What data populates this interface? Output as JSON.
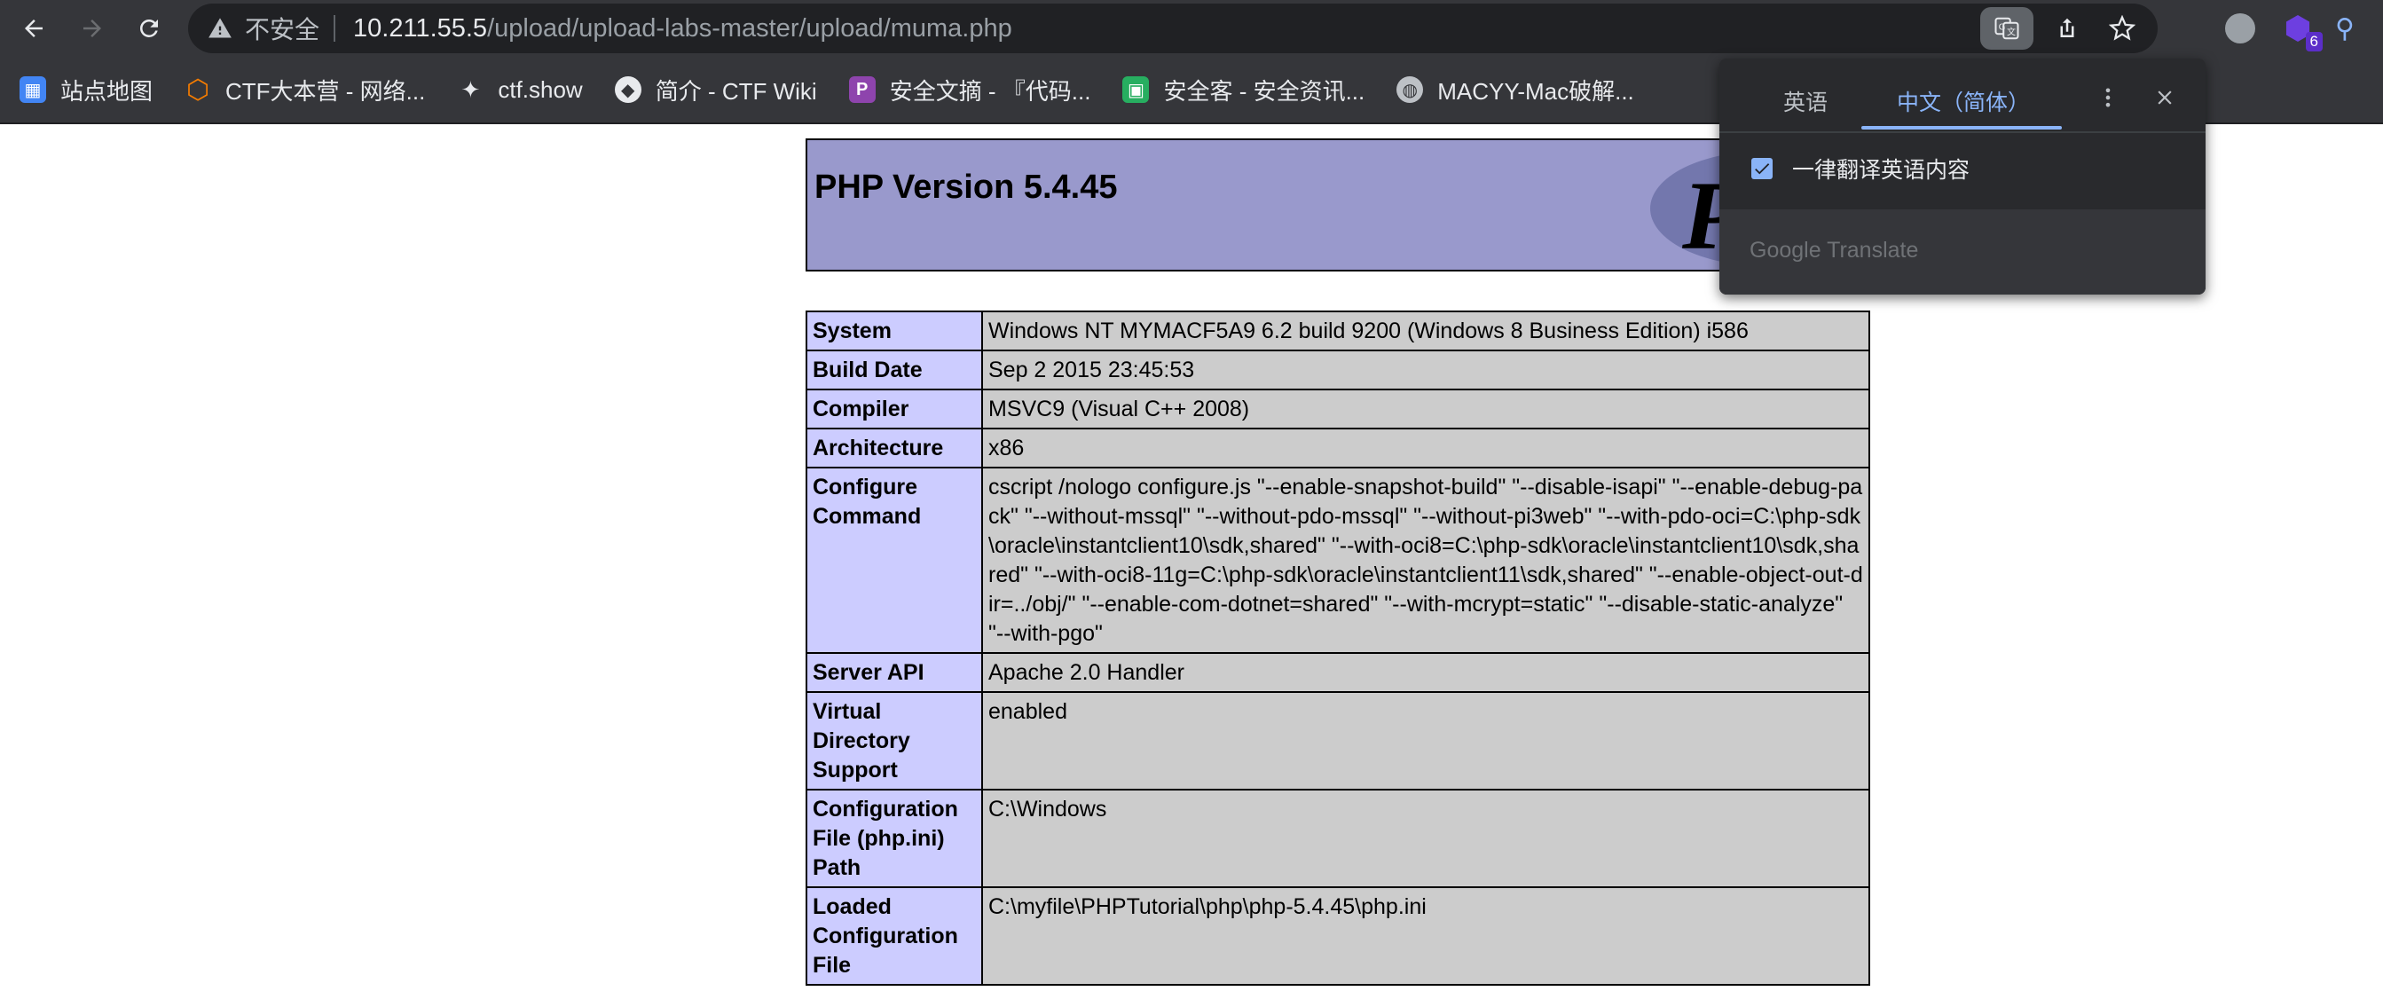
{
  "browser": {
    "omnibox": {
      "security_label": "不安全",
      "url_host": "10.211.55.5",
      "url_path": "/upload/upload-labs-master/upload/muma.php"
    },
    "extension_badge": "6"
  },
  "bookmarks": [
    {
      "label": "站点地图",
      "icon": "map-icon",
      "color": "#4285f4"
    },
    {
      "label": "CTF大本营 - 网络...",
      "icon": "ctf-logo-icon",
      "color": "#f57c00"
    },
    {
      "label": "ctf.show",
      "icon": "ctfshow-icon",
      "color": "#e8eaed"
    },
    {
      "label": "简介 - CTF Wiki",
      "icon": "ctfwiki-icon",
      "color": "#e8eaed"
    },
    {
      "label": "安全文摘 - 『代码...",
      "icon": "p-logo-icon",
      "color": "#8e44ad"
    },
    {
      "label": "安全客 - 安全资讯...",
      "icon": "anquanke-icon",
      "color": "#27ae60"
    },
    {
      "label": "MACYY-Mac破解...",
      "icon": "globe-icon",
      "color": "#bdc1c6"
    }
  ],
  "php": {
    "title": "PHP Version 5.4.45",
    "logo_text": "P",
    "rows": [
      {
        "key": "System",
        "value": "Windows NT MYMACF5A9 6.2 build 9200 (Windows 8 Business Edition) i586"
      },
      {
        "key": "Build Date",
        "value": "Sep 2 2015 23:45:53"
      },
      {
        "key": "Compiler",
        "value": "MSVC9 (Visual C++ 2008)"
      },
      {
        "key": "Architecture",
        "value": "x86"
      },
      {
        "key": "Configure Command",
        "value": "cscript /nologo configure.js \"--enable-snapshot-build\" \"--disable-isapi\" \"--enable-debug-pack\" \"--without-mssql\" \"--without-pdo-mssql\" \"--without-pi3web\" \"--with-pdo-oci=C:\\php-sdk\\oracle\\instantclient10\\sdk,shared\" \"--with-oci8=C:\\php-sdk\\oracle\\instantclient10\\sdk,shared\" \"--with-oci8-11g=C:\\php-sdk\\oracle\\instantclient11\\sdk,shared\" \"--enable-object-out-dir=../obj/\" \"--enable-com-dotnet=shared\" \"--with-mcrypt=static\" \"--disable-static-analyze\" \"--with-pgo\""
      },
      {
        "key": "Server API",
        "value": "Apache 2.0 Handler"
      },
      {
        "key": "Virtual Directory Support",
        "value": "enabled"
      },
      {
        "key": "Configuration File (php.ini) Path",
        "value": "C:\\Windows"
      },
      {
        "key": "Loaded Configuration File",
        "value": "C:\\myfile\\PHPTutorial\\php\\php-5.4.45\\php.ini"
      }
    ]
  },
  "translate": {
    "tab_source": "英语",
    "tab_target": "中文（简体）",
    "always_translate_label": "一律翻译英语内容",
    "always_translate_checked": true,
    "brand": "Google Translate"
  }
}
